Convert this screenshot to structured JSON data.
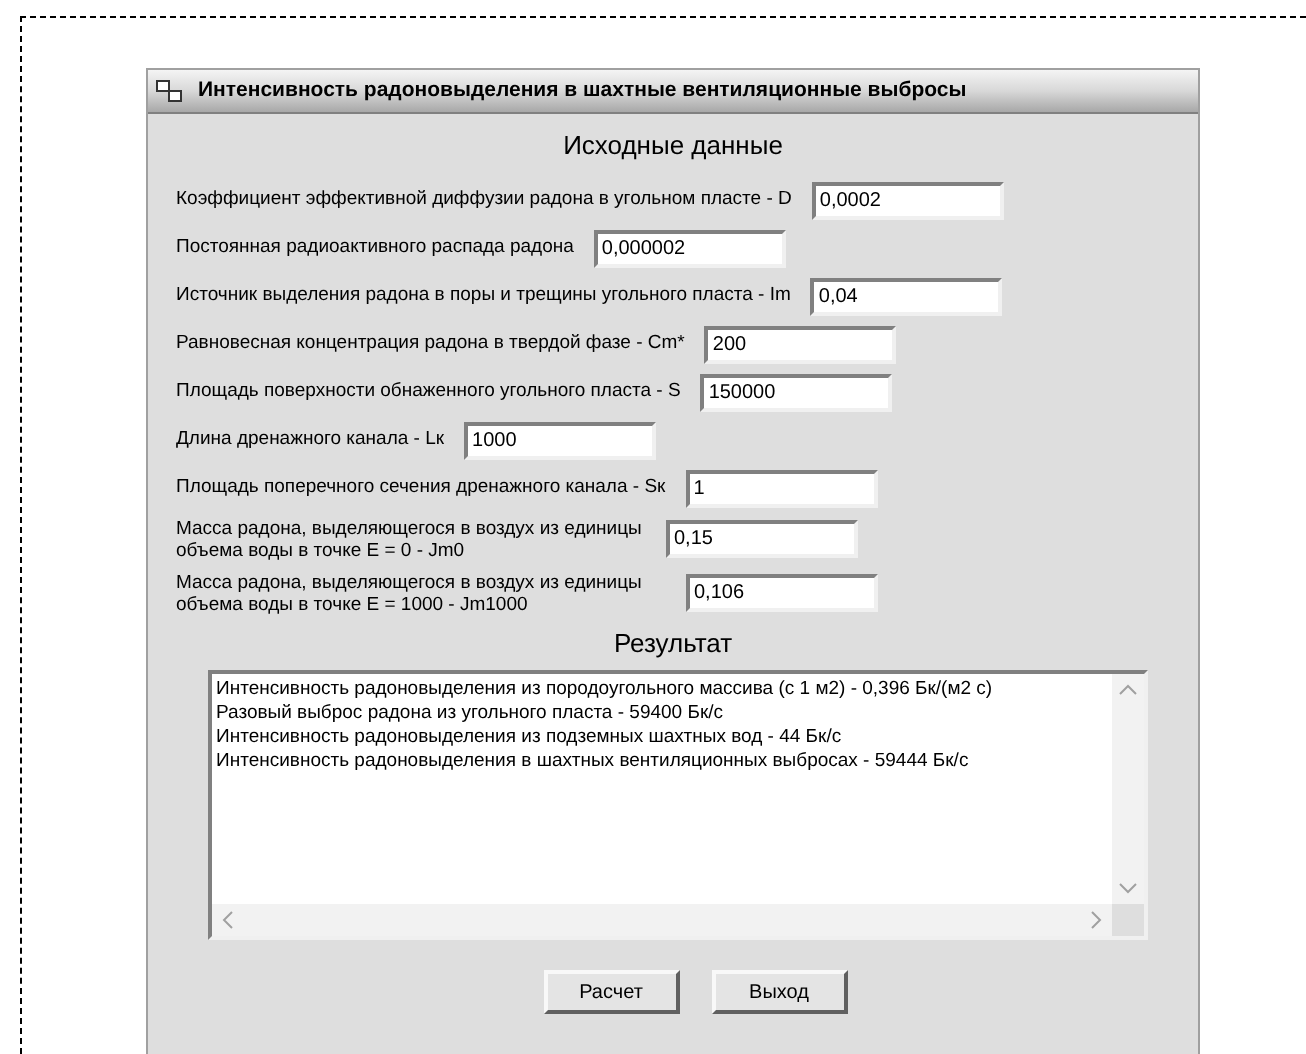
{
  "window": {
    "title": "Интенсивность радоновыделения в шахтные вентиляционные выбросы"
  },
  "input_section": {
    "heading": "Исходные данные",
    "fields": [
      {
        "label": "Коэффициент эффективной диффузии радона в угольном пласте - D",
        "value": "0,0002"
      },
      {
        "label": "Постоянная радиоактивного распада радона",
        "value": "0,000002"
      },
      {
        "label": "Источник выделения радона в поры и трещины угольного пласта - Im",
        "value": "0,04"
      },
      {
        "label": "Равновесная концентрация радона в твердой фазе - Cm*",
        "value": "200"
      },
      {
        "label": "Площадь поверхности обнаженного угольного пласта - S",
        "value": "150000"
      },
      {
        "label": "Длина дренажного канала - Lк",
        "value": "1000"
      },
      {
        "label": "Площадь поперечного сечения дренажного канала - Sк",
        "value": "1"
      },
      {
        "label": "Масса радона, выделяющегося в воздух из единицы объема воды в точке E = 0 - Jm0",
        "value": "0,15"
      },
      {
        "label": "Масса радона, выделяющегося в воздух из единицы объема воды в точке E = 1000  - Jm1000",
        "value": "0,106"
      }
    ]
  },
  "result_section": {
    "heading": "Результат",
    "lines": [
      "Интенсивность радоновыделения из породоугольного массива (с 1 м2) - 0,396 Бк/(м2 с)",
      "Разовый выброс радона из угольного пласта - 59400 Бк/с",
      "Интенсивность радоновыделения из подземных шахтных вод - 44 Бк/с",
      "Интенсивность радоновыделения в шахтных вентиляционных выбросах - 59444 Бк/с"
    ]
  },
  "buttons": [
    "Расчет",
    "Выход"
  ]
}
